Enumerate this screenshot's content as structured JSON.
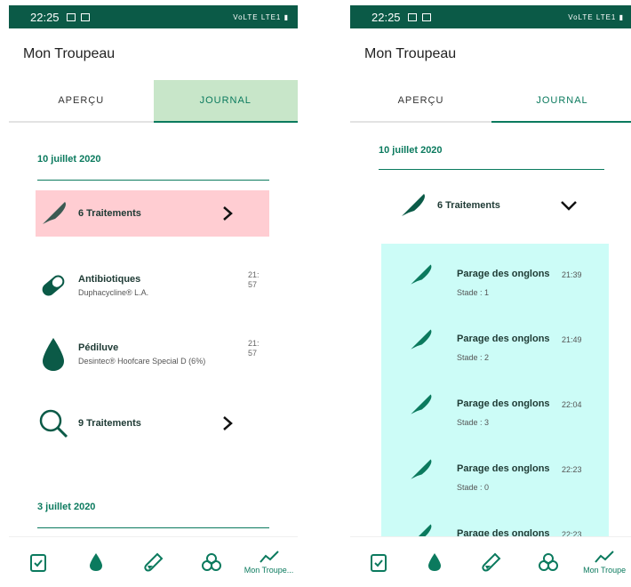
{
  "screen_left": {
    "status": {
      "time": "22:25",
      "net": "VoLTE LTE1"
    },
    "title": "Mon Troupeau",
    "tabs": [
      {
        "label": "APERÇU"
      },
      {
        "label": "JOURNAL"
      }
    ],
    "date1": "10 juillet 2020",
    "group1": {
      "label": "6 Traitements",
      "bg": "#ffcdd2"
    },
    "items": [
      {
        "label": "Antibiotiques",
        "sub": "Duphacycline® L.A.",
        "time": "21:57",
        "icon": "pill-icon"
      },
      {
        "label": "Pédiluve",
        "sub": "Desintec® Hoofcare Special D (6%)",
        "time": "21:57",
        "icon": "drop-icon"
      }
    ],
    "group2": {
      "label": "9 Traitements"
    },
    "date2": "3 juillet 2020",
    "nav": {
      "last_label": "Mon Troupe..."
    }
  },
  "screen_right": {
    "status": {
      "time": "22:25",
      "net": "VoLTE LTE1"
    },
    "title": "Mon Troupeau",
    "tabs": [
      {
        "label": "APERÇU"
      },
      {
        "label": "JOURNAL"
      }
    ],
    "date1": "10 juillet 2020",
    "group1": {
      "label": "6 Traitements"
    },
    "treatments": [
      {
        "label": "Parage des onglons",
        "stage": "Stade : 1",
        "time": "21:39"
      },
      {
        "label": "Parage des onglons",
        "stage": "Stade : 2",
        "time": "21:49"
      },
      {
        "label": "Parage des onglons",
        "stage": "Stade : 3",
        "time": "22:04"
      },
      {
        "label": "Parage des onglons",
        "stage": "Stade : 0",
        "time": "22:23"
      },
      {
        "label": "Parage des onglons",
        "stage": "",
        "time": "22:23"
      }
    ],
    "nav": {
      "last_label": "Mon Troupe"
    }
  },
  "colors": {
    "brand": "#0b5a47",
    "accent": "#0b7a5e",
    "panel": "#ccfcf7",
    "tab_active_bg": "#c8e6c9"
  }
}
